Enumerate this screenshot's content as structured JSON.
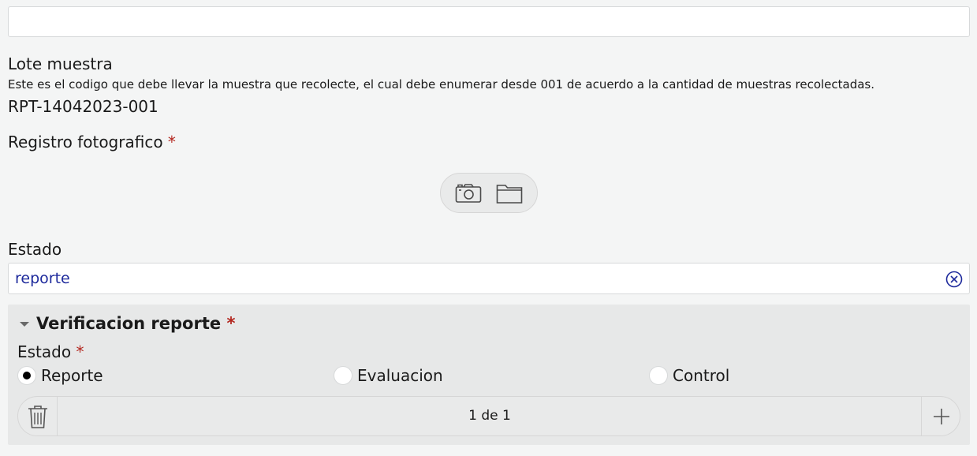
{
  "top_field": {
    "value": ""
  },
  "lote": {
    "label": "Lote muestra",
    "hint": "Este es el codigo que debe llevar la muestra que recolecte, el cual debe enumerar desde 001 de acuerdo a la cantidad de muestras recolectadas.",
    "value": "RPT-14042023-001"
  },
  "registro": {
    "label": "Registro fotografico",
    "required_mark": "*",
    "icons": [
      "camera-icon",
      "folder-icon"
    ]
  },
  "estado_field": {
    "label": "Estado",
    "value": "reporte",
    "clear_icon": "clear-circle-icon",
    "value_color": "#1e2a9c"
  },
  "verificacion": {
    "title": "Verificacion reporte",
    "required_mark": "*",
    "collapse_icon": "triangle-down-icon",
    "estado_label": "Estado",
    "estado_required_mark": "*",
    "options": [
      "Reporte",
      "Evaluacion",
      "Control"
    ],
    "selected": "Reporte",
    "pager": {
      "text": "1 de 1",
      "delete_icon": "trash-icon",
      "add_icon": "plus-icon"
    }
  },
  "colors": {
    "background": "#f4f5f5",
    "group_background": "#e7e8e8",
    "required": "#b3261e",
    "accent": "#1e2a9c"
  }
}
